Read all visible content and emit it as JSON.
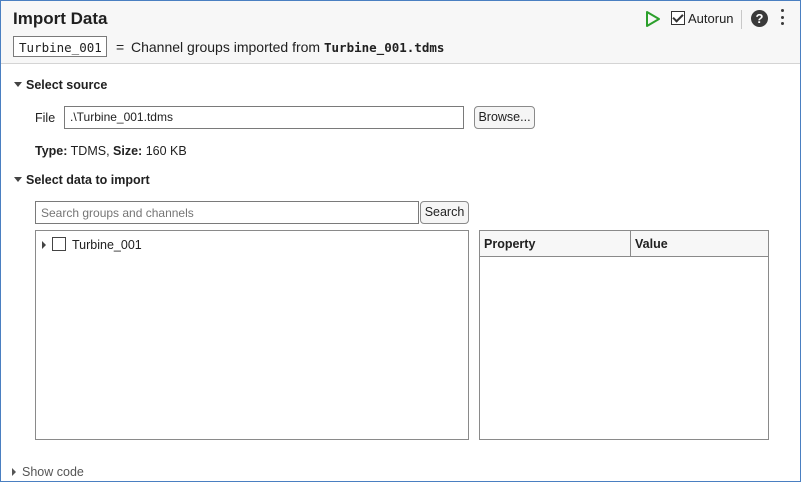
{
  "header": {
    "title": "Import Data",
    "variable_name": "Turbine_001",
    "equals": "=",
    "description_prefix": "Channel groups imported from",
    "description_file": "Turbine_001.tdms",
    "autorun_label": "Autorun",
    "autorun_checked": true,
    "help_glyph": "?",
    "icons": [
      "run-icon",
      "help-icon",
      "more-options-icon"
    ],
    "run_color": "#2ca02c"
  },
  "source": {
    "section_label": "Select source",
    "file_label": "File",
    "file_value": ".\\Turbine_001.tdms",
    "browse_label": "Browse...",
    "type_label": "Type:",
    "type_value": "TDMS,",
    "size_label": "Size:",
    "size_value": "160 KB"
  },
  "import": {
    "section_label": "Select data to import",
    "search_placeholder": "Search groups and channels",
    "search_button": "Search",
    "tree": [
      {
        "label": "Turbine_001",
        "checked": false,
        "expanded": false
      }
    ],
    "table_headers": [
      "Property",
      "Value"
    ]
  },
  "footer": {
    "show_code_label": "Show code"
  }
}
